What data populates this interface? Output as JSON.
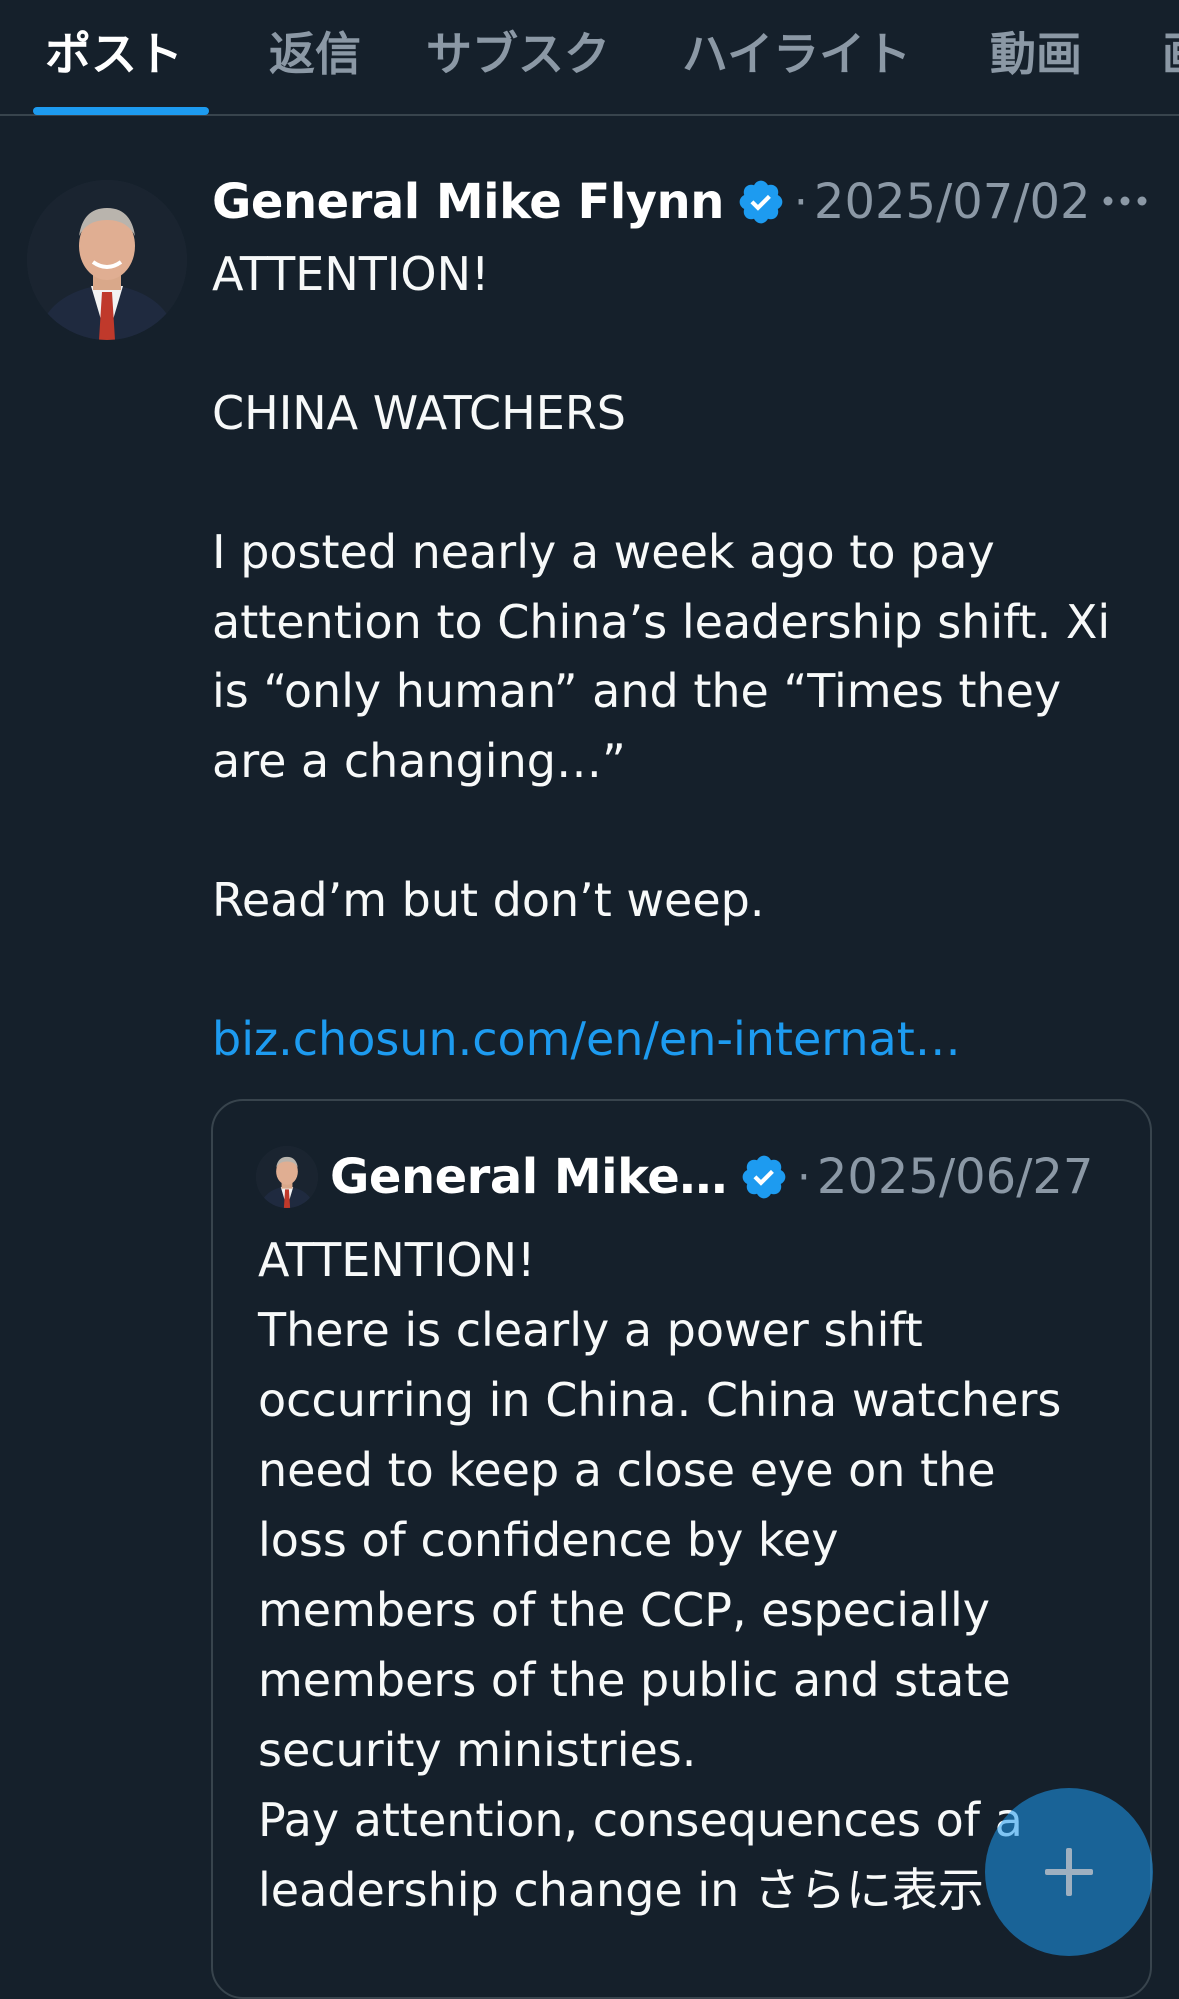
{
  "tabs": [
    {
      "label": "ポスト",
      "active": true
    },
    {
      "label": "返信",
      "active": false
    },
    {
      "label": "サブスク",
      "active": false
    },
    {
      "label": "ハイライト",
      "active": false
    },
    {
      "label": "動画",
      "active": false
    },
    {
      "label": "画",
      "active": false
    }
  ],
  "post": {
    "author": "General Mike Flynn",
    "verified": true,
    "separator": "·",
    "date": "2025/07/02",
    "more_icon": "more-horizontal-icon",
    "lines": {
      "l1": "ATTENTION!",
      "l2": "CHINA WATCHERS",
      "l3": "I posted nearly a week ago to pay",
      "l4": "attention to China’s leadership shift. Xi",
      "l5": "is “only human” and the “Times they",
      "l6": "are a changing…”",
      "l7": "Read’m but don’t weep."
    },
    "link": "biz.chosun.com/en/en-internat…"
  },
  "quote": {
    "author": "General Mike…",
    "verified": true,
    "separator": "·",
    "date": "2025/06/27",
    "lines": {
      "l1": "ATTENTION!",
      "l2": "There is clearly a power shift",
      "l3": "occurring in China. China watchers",
      "l4": "need to keep a close eye on the",
      "l5": "loss of confidence by key",
      "l6": "members of the CCP, especially",
      "l7": "members of the public and state",
      "l8": "security ministries.",
      "l9": "Pay attention, consequences of a",
      "l10": "leadership change in "
    },
    "show_more": "さらに表示"
  },
  "fab": {
    "icon": "plus-icon"
  },
  "colors": {
    "background": "#15202b",
    "accent": "#1d9bf0",
    "muted": "#8b98a5",
    "border": "#38444d"
  }
}
